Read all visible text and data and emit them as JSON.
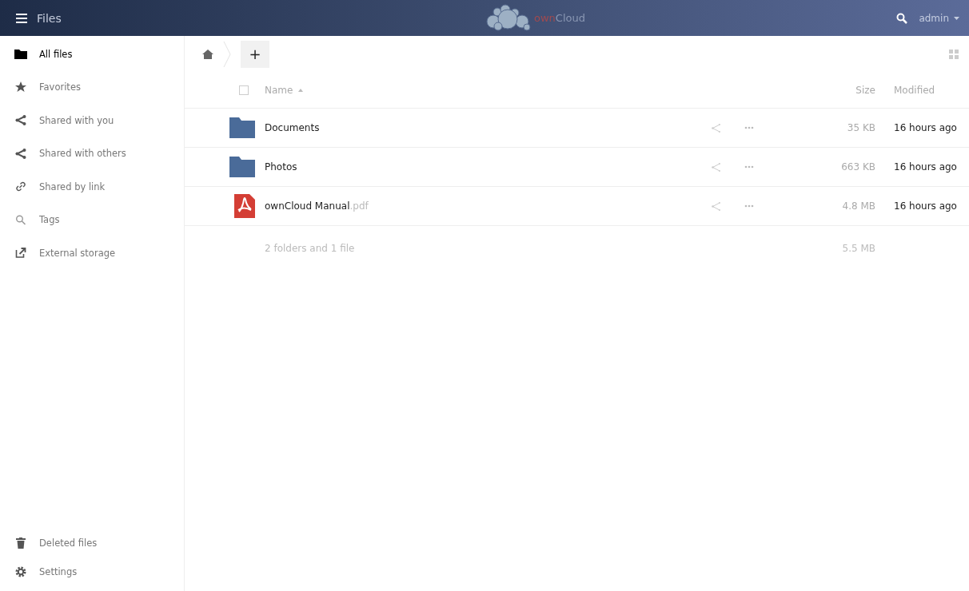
{
  "header": {
    "app_title": "Files",
    "brand_prefix": "own",
    "brand_rest": "Cloud",
    "user": "admin"
  },
  "sidebar": {
    "items": [
      {
        "label": "All files",
        "selected": true
      },
      {
        "label": "Favorites",
        "selected": false
      },
      {
        "label": "Shared with you",
        "selected": false
      },
      {
        "label": "Shared with others",
        "selected": false
      },
      {
        "label": "Shared by link",
        "selected": false
      },
      {
        "label": "Tags",
        "selected": false
      },
      {
        "label": "External storage",
        "selected": false
      }
    ],
    "footer_items": [
      {
        "label": "Deleted files"
      },
      {
        "label": "Settings"
      }
    ]
  },
  "toolbar": {
    "new_button": "+"
  },
  "table": {
    "select_all": {
      "checked": false
    },
    "columns": {
      "name": "Name",
      "size": "Size",
      "modified": "Modified"
    },
    "rows": [
      {
        "kind": "folder",
        "name": "Documents",
        "size": "35 KB",
        "modified": "16 hours ago"
      },
      {
        "kind": "folder",
        "name": "Photos",
        "size": "663 KB",
        "modified": "16 hours ago"
      },
      {
        "kind": "pdf",
        "name": "ownCloud Manual",
        "extension": ".pdf",
        "size": "4.8 MB",
        "modified": "16 hours ago"
      }
    ],
    "summary": {
      "text": "2 folders and 1 file",
      "size": "5.5 MB"
    }
  }
}
